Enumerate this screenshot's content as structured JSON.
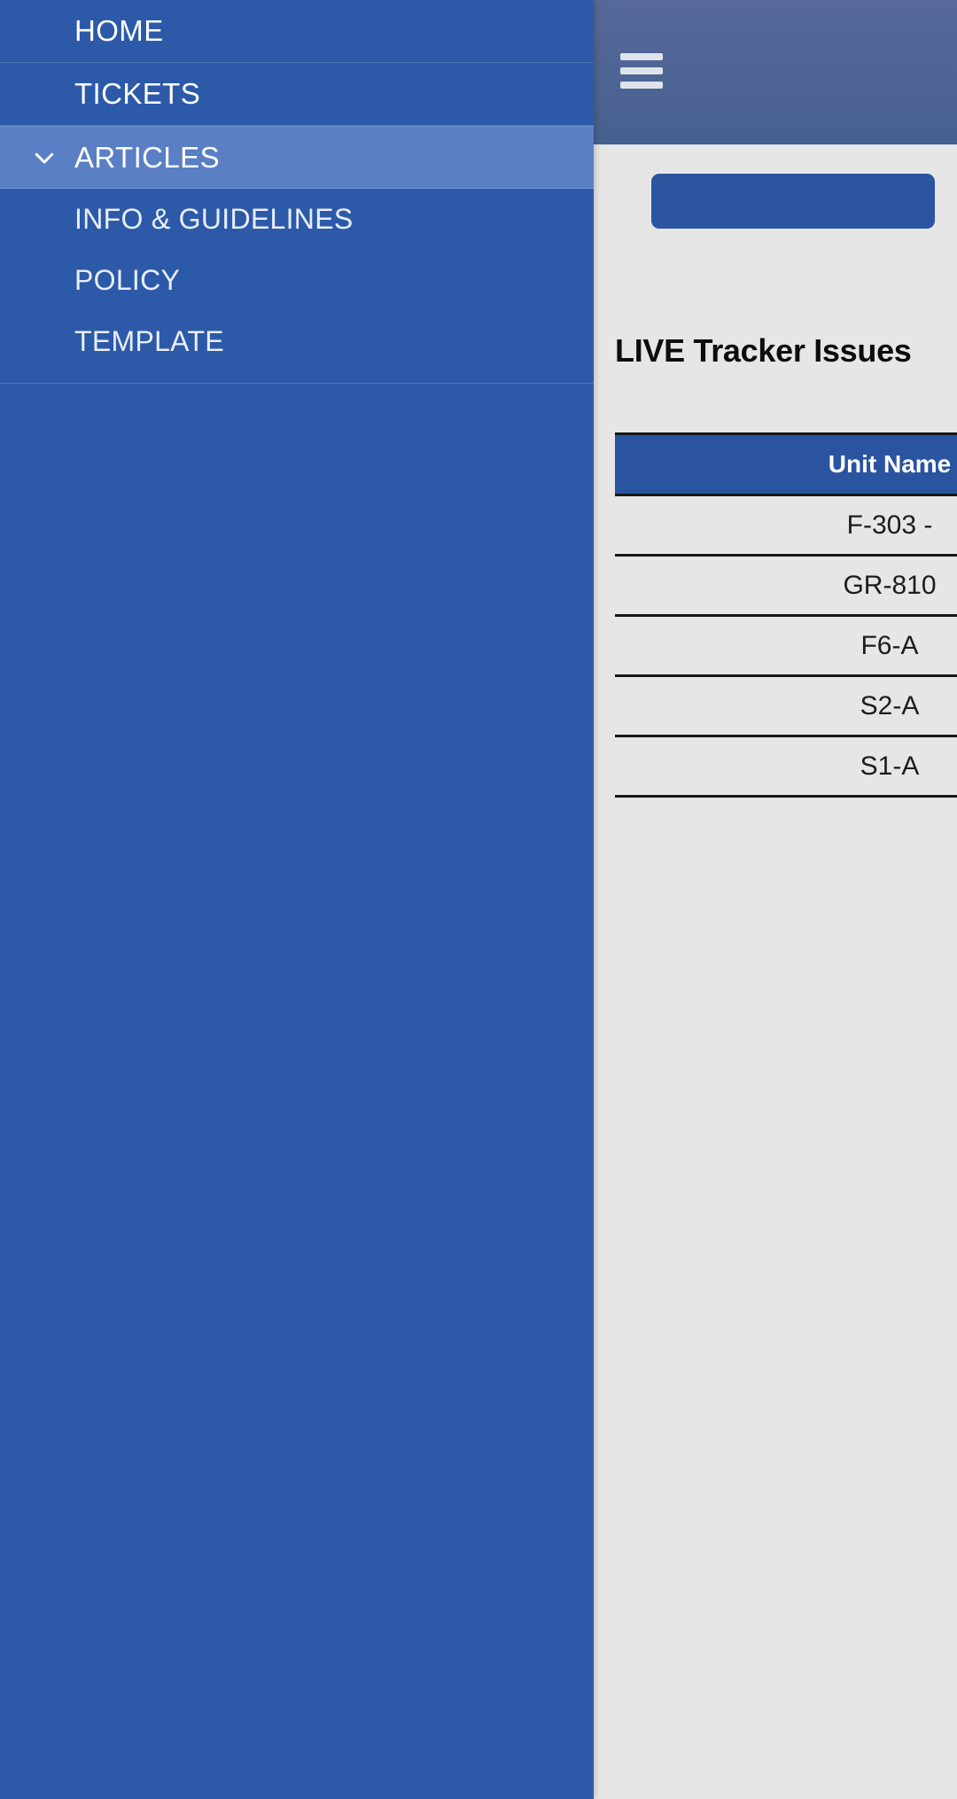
{
  "topbar": {
    "menu_icon": "hamburger-menu-icon"
  },
  "content": {
    "action_button_label": "",
    "heading": "LIVE Tracker Issues"
  },
  "table": {
    "columns": [
      "Unit Name"
    ],
    "rows": [
      [
        "F-303 -"
      ],
      [
        "GR-810"
      ],
      [
        "F6-A"
      ],
      [
        "S2-A"
      ],
      [
        "S1-A"
      ]
    ]
  },
  "nav": {
    "items": [
      {
        "label": "HOME",
        "has_chevron": false,
        "active": false
      },
      {
        "label": "TICKETS",
        "has_chevron": false,
        "active": false
      },
      {
        "label": "ARTICLES",
        "has_chevron": true,
        "active": true,
        "chevron_icon": "chevron-down-icon"
      }
    ],
    "sub_items": [
      {
        "label": "INFO & GUIDELINES"
      },
      {
        "label": "POLICY"
      },
      {
        "label": "TEMPLATE"
      }
    ]
  },
  "colors": {
    "nav_background": "#2c5aa9",
    "nav_active": "#5a7fc4",
    "topbar": "#4b6496",
    "content_background": "#e6e6e6",
    "accent_button": "#2c55a0",
    "table_header": "#2a54a0"
  }
}
